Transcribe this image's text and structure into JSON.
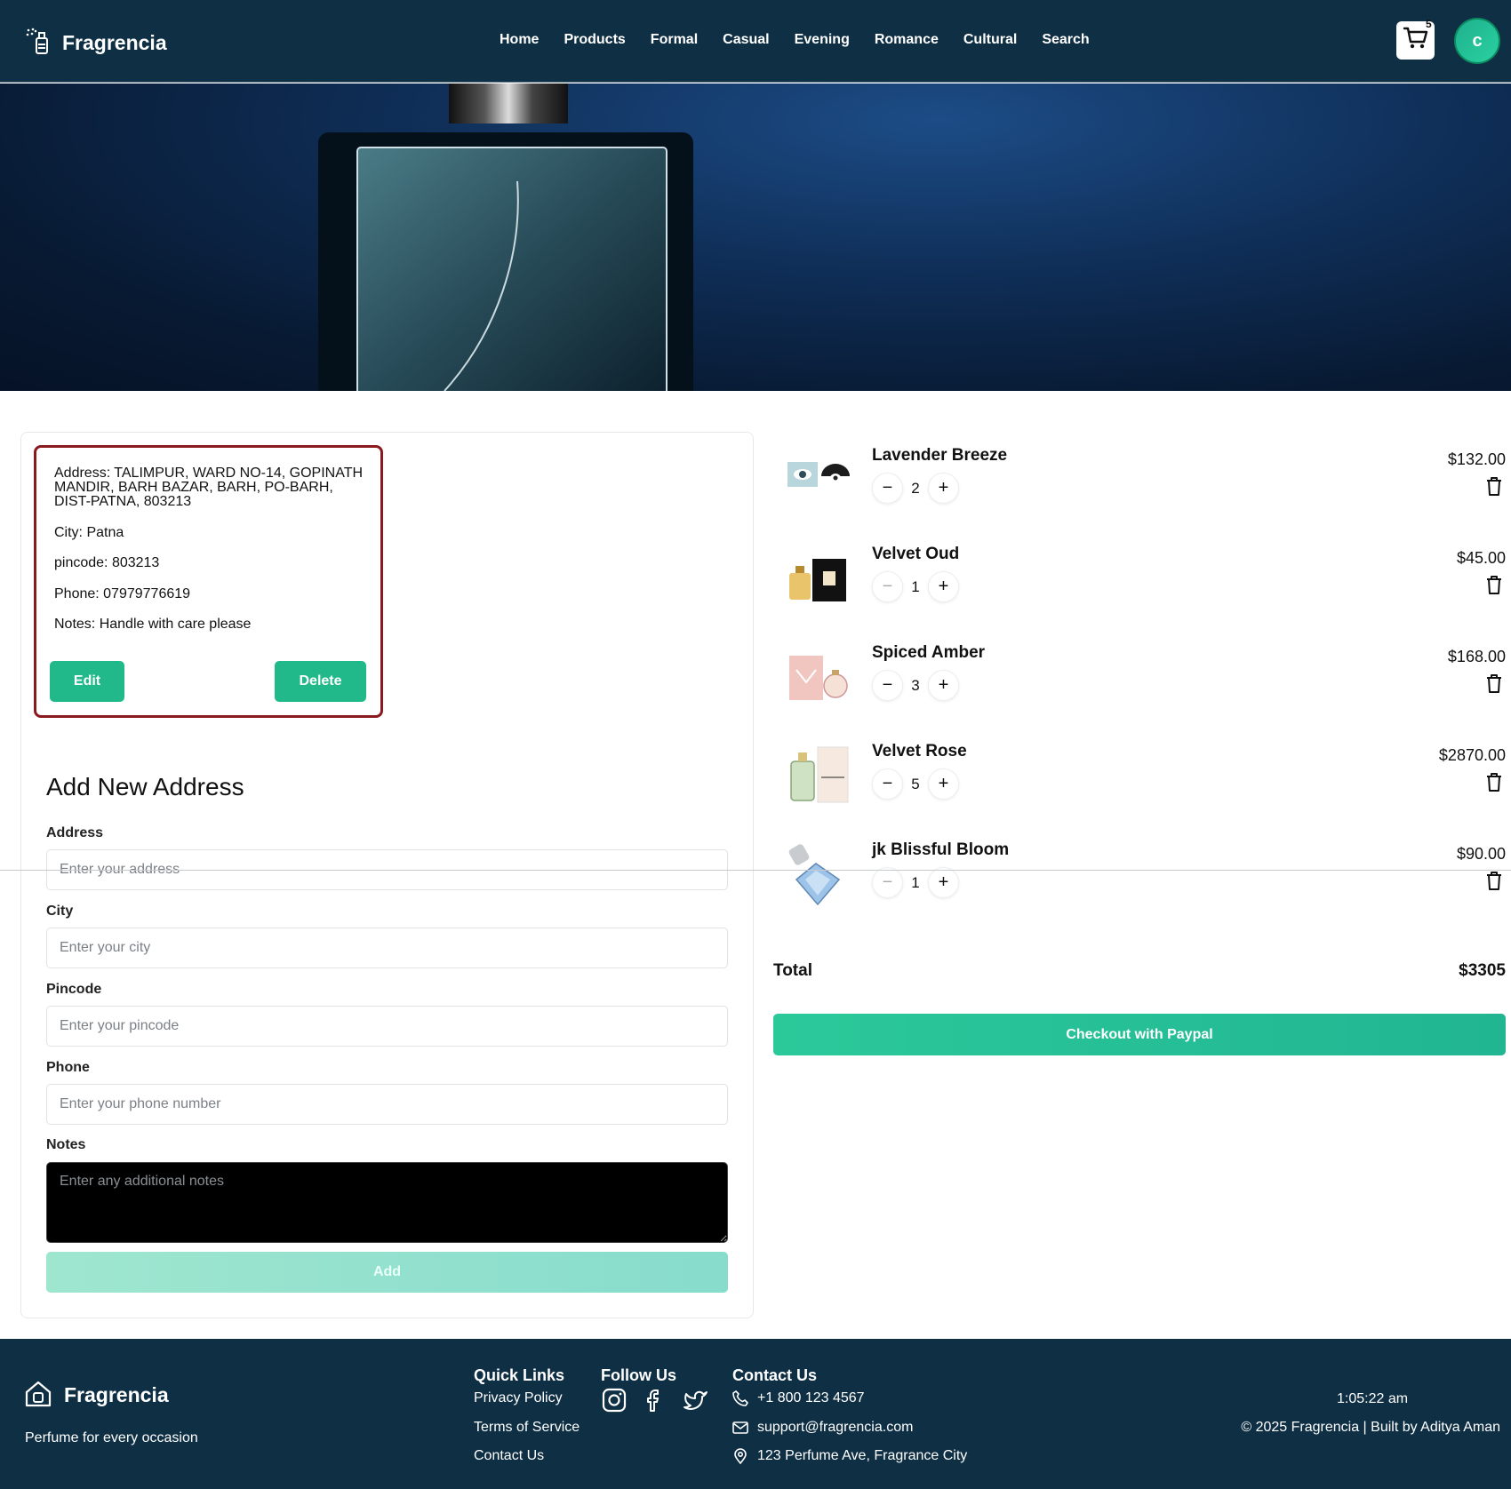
{
  "header": {
    "brand": "Fragrencia",
    "nav": [
      "Home",
      "Products",
      "Formal",
      "Casual",
      "Evening",
      "Romance",
      "Cultural",
      "Search"
    ],
    "cart_count": "5",
    "avatar_initial": "c"
  },
  "saved_address": {
    "address_line": "Address: TALIMPUR, WARD NO-14, GOPINATH",
    "address_line2": "MANDIR, BARH BAZAR, BARH, PO-BARH,",
    "address_line3": "DIST-PATNA, 803213",
    "city": "City: Patna",
    "pincode": "pincode: 803213",
    "phone": "Phone: 07979776619",
    "notes": "Notes: Handle with care please",
    "edit_label": "Edit",
    "delete_label": "Delete"
  },
  "form": {
    "title": "Add New Address",
    "address_label": "Address",
    "address_placeholder": "Enter your address",
    "city_label": "City",
    "city_placeholder": "Enter your city",
    "pincode_label": "Pincode",
    "pincode_placeholder": "Enter your pincode",
    "phone_label": "Phone",
    "phone_placeholder": "Enter your phone number",
    "notes_label": "Notes",
    "notes_placeholder": "Enter any additional notes",
    "add_label": "Add"
  },
  "cart": {
    "items": [
      {
        "name": "Lavender Breeze",
        "qty": "2",
        "price": "$132.00"
      },
      {
        "name": "Velvet Oud",
        "qty": "1",
        "price": "$45.00"
      },
      {
        "name": "Spiced Amber",
        "qty": "3",
        "price": "$168.00"
      },
      {
        "name": "Velvet Rose",
        "qty": "5",
        "price": "$2870.00"
      },
      {
        "name": "jk Blissful Bloom",
        "qty": "1",
        "price": "$90.00"
      }
    ],
    "total_label": "Total",
    "total_value": "$3305",
    "checkout_label": "Checkout with Paypal"
  },
  "footer": {
    "brand": "Fragrencia",
    "tagline": "Perfume for every occasion",
    "quick_links_title": "Quick Links",
    "quick_links": [
      "Privacy Policy",
      "Terms of Service",
      "Contact Us"
    ],
    "follow_title": "Follow Us",
    "contact_title": "Contact Us",
    "phone": "+1 800 123 4567",
    "email": "support@fragrencia.com",
    "address": "123 Perfume Ave, Fragrance City",
    "time": "1:05:22 am",
    "copyright": "© 2025 Fragrencia | Built by Aditya Aman"
  },
  "icons": [
    "perfume-logo-icon",
    "cart-icon",
    "minus-icon",
    "plus-icon",
    "trash-icon",
    "instagram-icon",
    "facebook-icon",
    "twitter-icon",
    "phone-icon",
    "mail-icon",
    "location-pin-icon"
  ],
  "colors": {
    "header_bg": "#0f2f44",
    "accent": "#22b98a",
    "address_border": "#8b1a1f"
  }
}
